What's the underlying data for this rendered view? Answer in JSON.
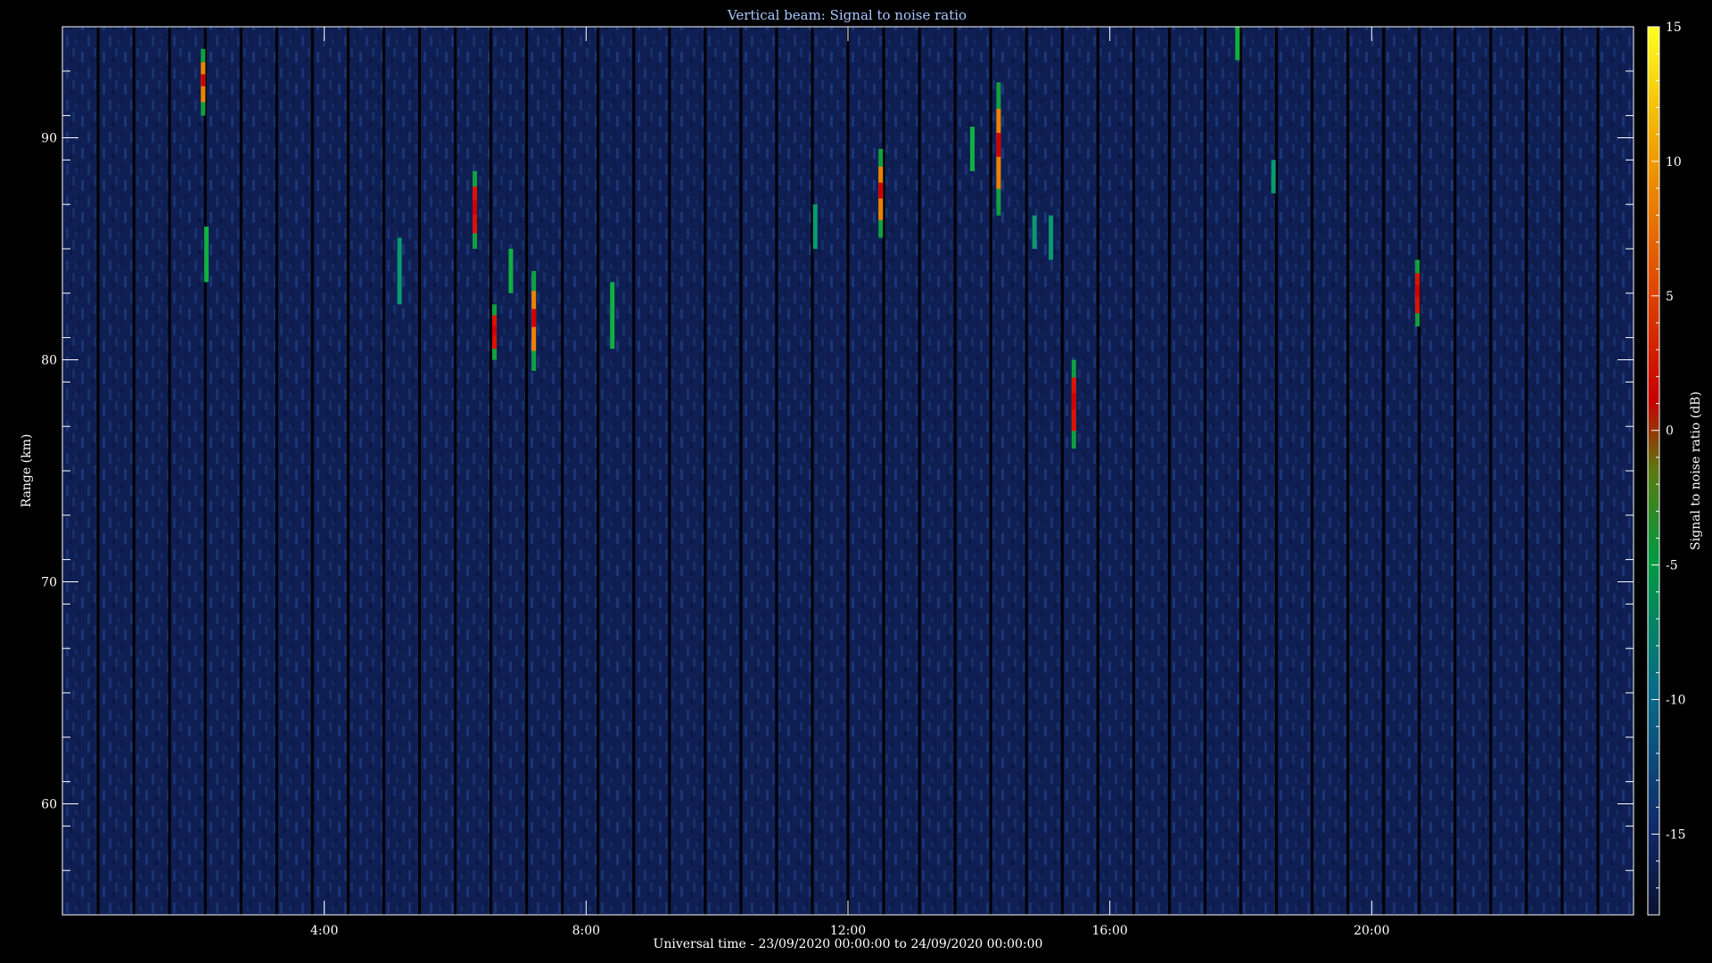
{
  "chart_data": {
    "type": "heatmap",
    "title": "Vertical beam: Signal to noise ratio",
    "xlabel": "Universal time - 23/09/2020 00:00:00 to 24/09/2020 00:00:00",
    "ylabel": "Range (km)",
    "colorbar_label": "Signal to noise ratio (dB)",
    "x_range_hours": [
      0,
      24
    ],
    "x_ticks": [
      {
        "value": 4,
        "label": "4:00"
      },
      {
        "value": 8,
        "label": "8:00"
      },
      {
        "value": 12,
        "label": "12:00"
      },
      {
        "value": 16,
        "label": "16:00"
      },
      {
        "value": 20,
        "label": "20:00"
      }
    ],
    "y_range_km": [
      55,
      95
    ],
    "y_ticks": [
      {
        "value": 60,
        "label": "60"
      },
      {
        "value": 70,
        "label": "70"
      },
      {
        "value": 80,
        "label": "80"
      },
      {
        "value": 90,
        "label": "90"
      }
    ],
    "colorbar_range_db": [
      -18,
      15
    ],
    "colorbar_ticks": [
      {
        "value": 15,
        "label": "15"
      },
      {
        "value": 10,
        "label": "10"
      },
      {
        "value": 5,
        "label": "5"
      },
      {
        "value": 0,
        "label": "0"
      },
      {
        "value": -5,
        "label": "-5"
      },
      {
        "value": -10,
        "label": "-10"
      },
      {
        "value": -15,
        "label": "-15"
      }
    ],
    "background_color": "#0f1f54",
    "gap_color": "#000000",
    "echoes": [
      {
        "time_h": 2.15,
        "range_top_km": 94,
        "range_bottom_km": 91,
        "peak_db": 7
      },
      {
        "time_h": 2.2,
        "range_top_km": 86,
        "range_bottom_km": 83.5,
        "peak_db": -4
      },
      {
        "time_h": 5.15,
        "range_top_km": 85.5,
        "range_bottom_km": 82.5,
        "peak_db": -6
      },
      {
        "time_h": 6.3,
        "range_top_km": 88.5,
        "range_bottom_km": 85,
        "peak_db": 4
      },
      {
        "time_h": 6.6,
        "range_top_km": 82.5,
        "range_bottom_km": 80,
        "peak_db": 3
      },
      {
        "time_h": 6.85,
        "range_top_km": 85,
        "range_bottom_km": 83,
        "peak_db": -5
      },
      {
        "time_h": 7.2,
        "range_top_km": 84,
        "range_bottom_km": 79.5,
        "peak_db": 5
      },
      {
        "time_h": 8.4,
        "range_top_km": 83.5,
        "range_bottom_km": 80.5,
        "peak_db": -5
      },
      {
        "time_h": 11.5,
        "range_top_km": 87,
        "range_bottom_km": 85,
        "peak_db": -7
      },
      {
        "time_h": 12.5,
        "range_top_km": 89.5,
        "range_bottom_km": 85.5,
        "peak_db": 6
      },
      {
        "time_h": 13.9,
        "range_top_km": 90.5,
        "range_bottom_km": 88.5,
        "peak_db": -3
      },
      {
        "time_h": 14.3,
        "range_top_km": 92.5,
        "range_bottom_km": 86.5,
        "peak_db": 5
      },
      {
        "time_h": 14.85,
        "range_top_km": 86.5,
        "range_bottom_km": 85,
        "peak_db": -7
      },
      {
        "time_h": 15.1,
        "range_top_km": 86.5,
        "range_bottom_km": 84.5,
        "peak_db": -6
      },
      {
        "time_h": 15.45,
        "range_top_km": 80,
        "range_bottom_km": 76,
        "peak_db": 4
      },
      {
        "time_h": 17.95,
        "range_top_km": 95,
        "range_bottom_km": 93.5,
        "peak_db": -4
      },
      {
        "time_h": 18.5,
        "range_top_km": 89,
        "range_bottom_km": 87.5,
        "peak_db": -7
      },
      {
        "time_h": 20.7,
        "range_top_km": 84.5,
        "range_bottom_km": 81.5,
        "peak_db": 3
      }
    ]
  }
}
